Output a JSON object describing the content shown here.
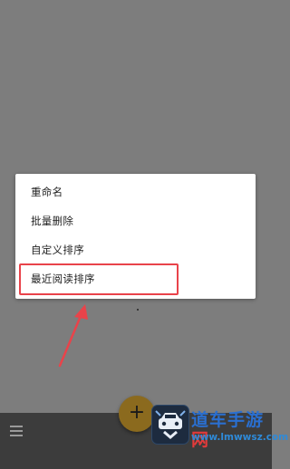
{
  "menu": {
    "items": [
      "重命名",
      "批量删除",
      "自定义排序",
      "最近阅读排序"
    ],
    "highlighted_index": 3
  },
  "fab": {
    "icon": "plus-icon",
    "label": "+"
  },
  "bottom_bar": {
    "menu_icon": "hamburger-menu-icon"
  },
  "watermark": {
    "brand_blue": "道车手游",
    "brand_red": "网",
    "url": "www.lmwwsz.com"
  },
  "colors": {
    "annotation": "#e9434a",
    "fab": "#8b6a1e",
    "watermark": "#2a6fd0"
  }
}
